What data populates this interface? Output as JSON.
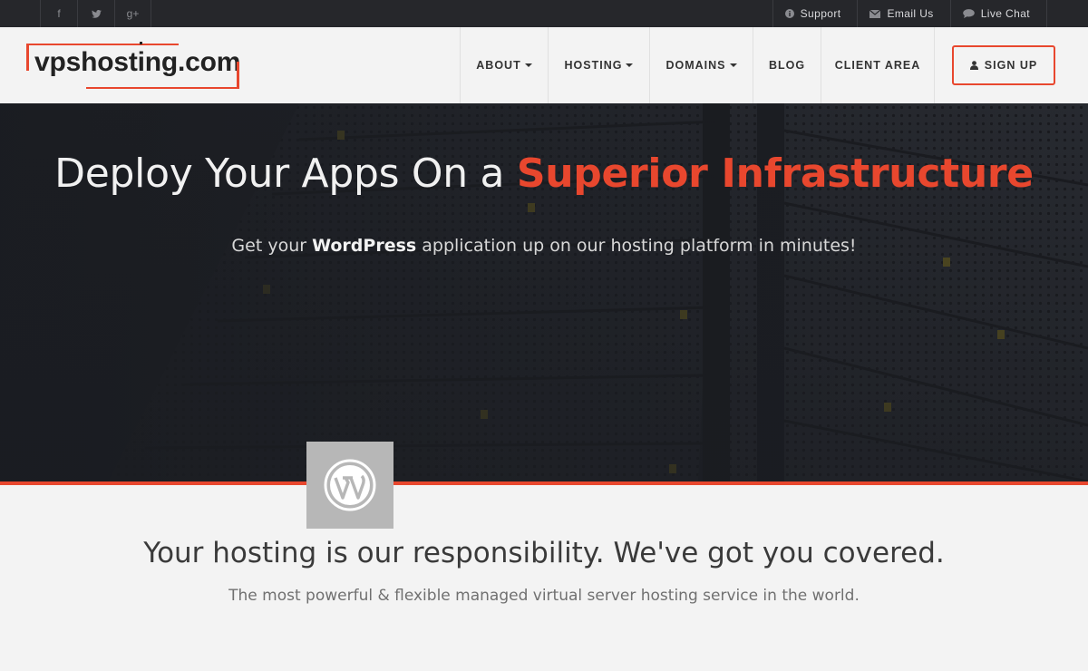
{
  "topbar": {
    "social": [
      {
        "icon": "facebook-icon",
        "glyph": "f"
      },
      {
        "icon": "twitter-icon",
        "glyph": "t"
      },
      {
        "icon": "google-plus-icon",
        "glyph": "g+"
      }
    ],
    "links": [
      {
        "label": "Support",
        "icon": "info-icon"
      },
      {
        "label": "Email Us",
        "icon": "envelope-icon"
      },
      {
        "label": "Live Chat",
        "icon": "chat-bubble-icon"
      }
    ]
  },
  "header": {
    "logo_text": "vpshosting.com",
    "nav": [
      {
        "label": "ABOUT",
        "dropdown": true
      },
      {
        "label": "HOSTING",
        "dropdown": true
      },
      {
        "label": "DOMAINS",
        "dropdown": true
      },
      {
        "label": "BLOG",
        "dropdown": false
      },
      {
        "label": "CLIENT AREA",
        "dropdown": false
      }
    ],
    "signup_label": "SIGN UP"
  },
  "hero": {
    "title_plain": "Deploy Your Apps On a ",
    "title_highlight": "Superior Infrastructure",
    "sub_prefix": "Get your ",
    "sub_bold": "WordPress",
    "sub_suffix": " application up on our hosting platform in minutes!"
  },
  "badge": {
    "icon": "wordpress-icon"
  },
  "section": {
    "tagline": "Your hosting is our responsibility. We've got you covered.",
    "subtagline": "The most powerful & flexible managed virtual server hosting service in the world."
  },
  "colors": {
    "accent": "#e8472e",
    "topbar": "#26272b",
    "hero_bg": "#1d1f24",
    "page_bg": "#f3f3f3"
  }
}
